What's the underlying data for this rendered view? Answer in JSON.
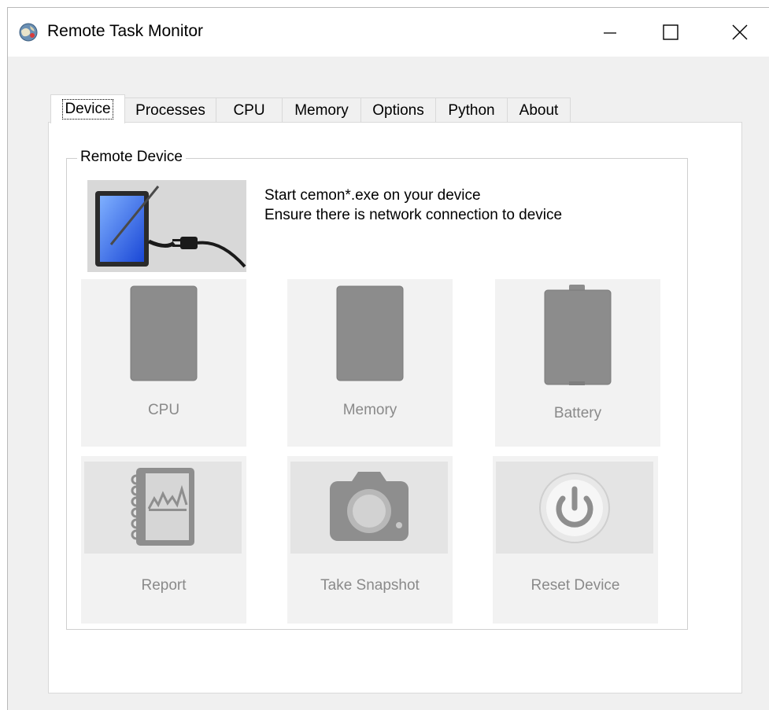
{
  "window": {
    "title": "Remote Task Monitor",
    "controls": {
      "minimize": "minimize-icon",
      "maximize": "maximize-icon",
      "close": "close-icon"
    }
  },
  "tabs": [
    {
      "label": "Device",
      "active": true
    },
    {
      "label": "Processes",
      "active": false
    },
    {
      "label": "CPU",
      "active": false
    },
    {
      "label": "Memory",
      "active": false
    },
    {
      "label": "Options",
      "active": false
    },
    {
      "label": "Python",
      "active": false
    },
    {
      "label": "About",
      "active": false
    }
  ],
  "device": {
    "group_title": "Remote Device",
    "info_line1": "Start cemon*.exe on your device",
    "info_line2": "Ensure there is network connection to device",
    "picture_icon": "tablet-plug-icon",
    "tiles": [
      {
        "label": "CPU",
        "icon": "cpu-icon"
      },
      {
        "label": "Memory",
        "icon": "memory-icon"
      },
      {
        "label": "Battery",
        "icon": "battery-icon"
      },
      {
        "label": "Report",
        "icon": "report-icon"
      },
      {
        "label": "Take Snapshot",
        "icon": "camera-icon"
      },
      {
        "label": "Reset Device",
        "icon": "power-icon"
      }
    ]
  },
  "colors": {
    "window_bg": "#f0f0f0",
    "page_bg": "#ffffff",
    "tile_bg": "#f2f2f2",
    "tile_text": "#8a8a8a",
    "tile_icon": "#8c8c8c"
  }
}
